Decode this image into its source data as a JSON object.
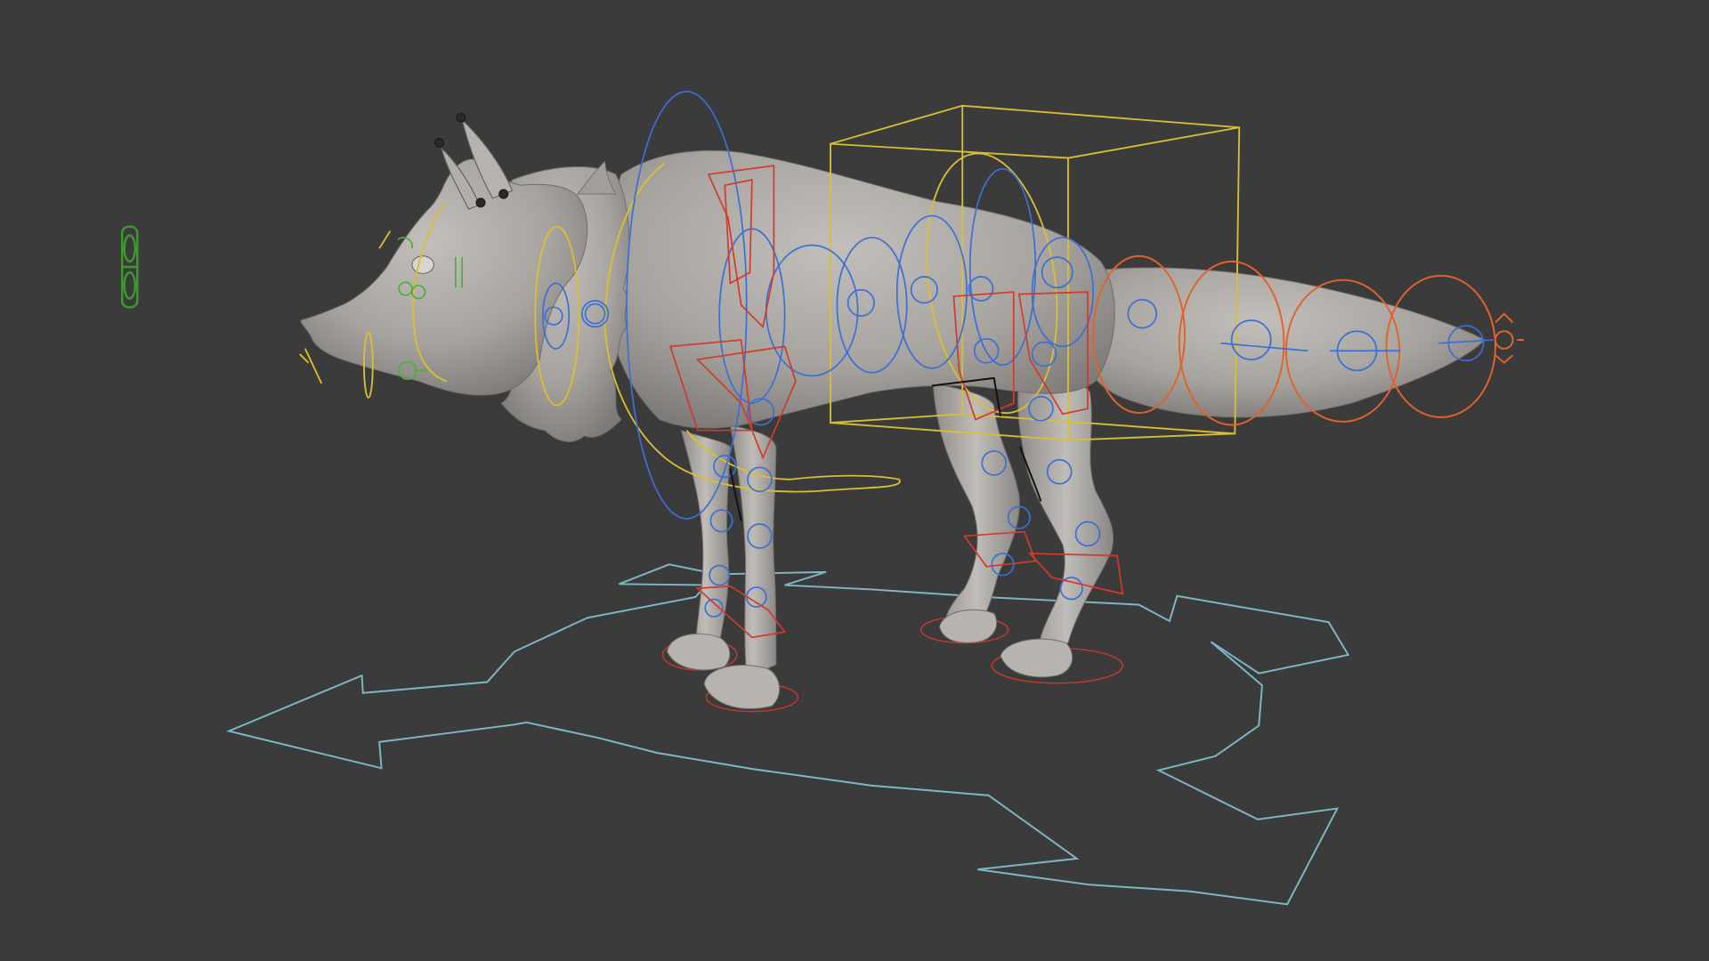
{
  "viewport": {
    "background_color": "#3b3b3b",
    "subject": "wolf-rig",
    "mesh_color": "#a9a6a2",
    "controls": {
      "world_control_color": "#7fb7c4",
      "spine_fk_color": "#3c6fd6",
      "ik_box_color": "#d9bf33",
      "limb_ik_color": "#d23a2a",
      "tail_control_color": "#e0632e",
      "face_control_color": "#4fae3c",
      "eye_target_color": "#3d9a2e"
    }
  }
}
